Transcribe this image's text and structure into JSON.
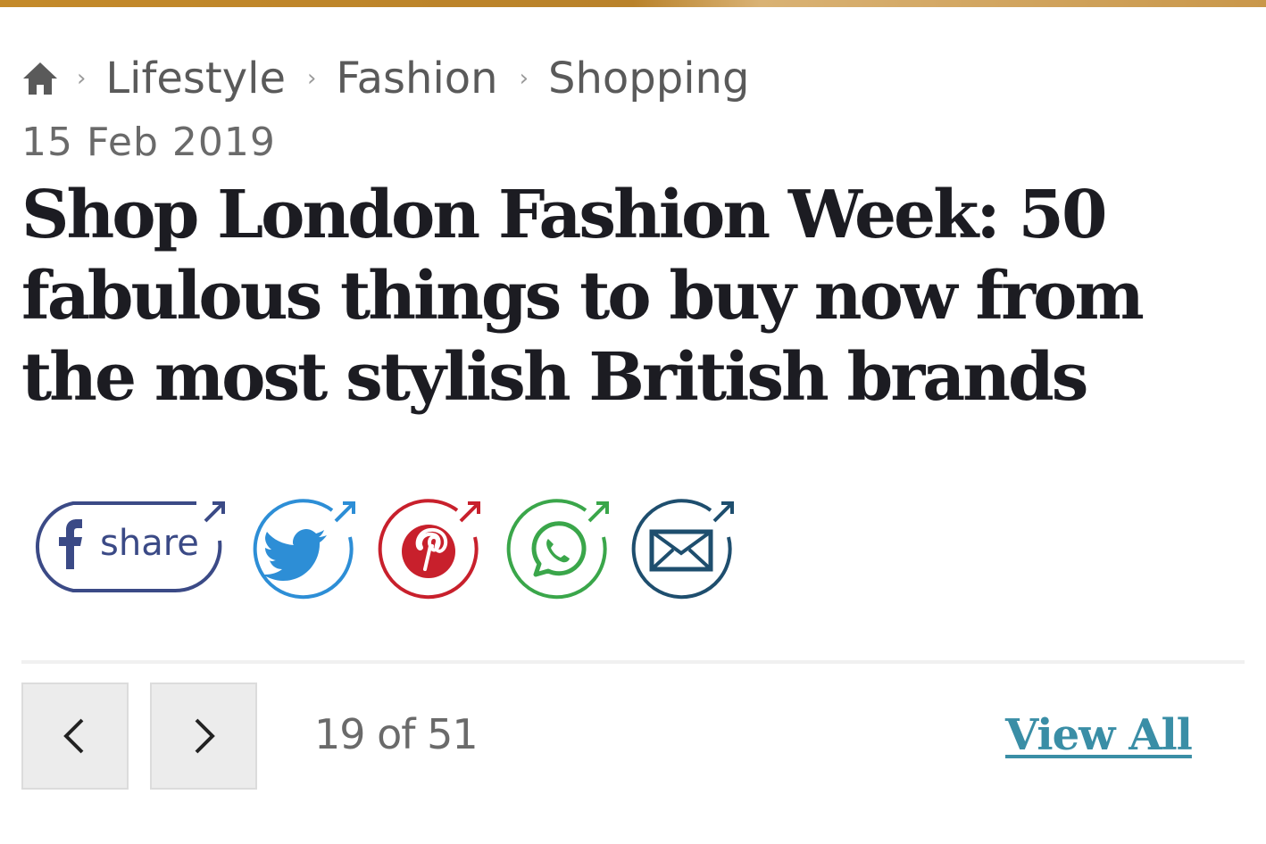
{
  "colors": {
    "top_bar": "#c48a2a",
    "headline": "#1c1c22",
    "breadcrumb": "#5a5a5a",
    "facebook": "#3b4a86",
    "twitter": "#2d8ed6",
    "pinterest": "#c8202c",
    "whatsapp": "#3aa64a",
    "email": "#1e4e6e",
    "link": "#3a8ea6"
  },
  "breadcrumb": {
    "home_icon": "home-icon",
    "items": [
      "Lifestyle",
      "Fashion",
      "Shopping"
    ],
    "separator": "›"
  },
  "article": {
    "date": "15 Feb 2019",
    "headline": "Shop London Fashion Week: 50 fabulous things to buy now from the most stylish British brands"
  },
  "share": {
    "facebook_label": "share",
    "buttons": [
      "facebook-icon",
      "twitter-icon",
      "pinterest-icon",
      "whatsapp-icon",
      "email-icon"
    ]
  },
  "gallery": {
    "prev_icon": "chevron-left-icon",
    "next_icon": "chevron-right-icon",
    "position_text": "19 of 51",
    "current": 19,
    "total": 51,
    "view_all_label": "View All"
  }
}
